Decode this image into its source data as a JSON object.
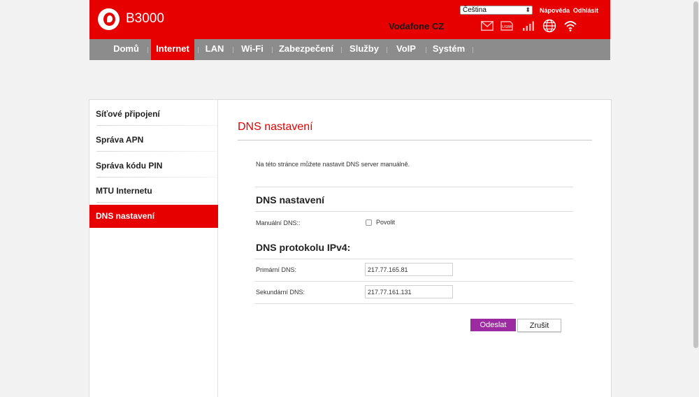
{
  "header": {
    "model": "B3000",
    "operator": "Vodafone CZ",
    "language": "Čeština",
    "help_link": "Nápověda",
    "logout_link": "Odhlásit",
    "sim_label": "USIM",
    "brand_color": "#e60000"
  },
  "nav": {
    "items": [
      {
        "label": "Domů"
      },
      {
        "label": "Internet"
      },
      {
        "label": "LAN"
      },
      {
        "label": "Wi-Fi"
      },
      {
        "label": "Zabezpečení"
      },
      {
        "label": "Služby"
      },
      {
        "label": "VoIP"
      },
      {
        "label": "Systém"
      }
    ],
    "active": "Internet"
  },
  "sidebar": {
    "items": [
      {
        "label": "Síťové připojení"
      },
      {
        "label": "Správa APN"
      },
      {
        "label": "Správa kódu PIN"
      },
      {
        "label": "MTU Internetu"
      },
      {
        "label": "DNS nastavení"
      }
    ],
    "active": "DNS nastavení"
  },
  "content": {
    "title": "DNS nastavení",
    "description": "Na této stránce můžete nastavit DNS server manuálně.",
    "section1_heading": "DNS nastavení",
    "manual_dns_label": "Manuální DNS::",
    "manual_dns_option": "Povolit",
    "manual_dns_checked": false,
    "section2_heading": "DNS protokolu IPv4:",
    "primary_dns_label": "Primární DNS:",
    "primary_dns_value": "217.77.165.81",
    "secondary_dns_label": "Sekundární DNS:",
    "secondary_dns_value": "217.77.161.131",
    "submit_label": "Odeslat",
    "cancel_label": "Zrušit",
    "submit_color": "#9c2aa0"
  }
}
